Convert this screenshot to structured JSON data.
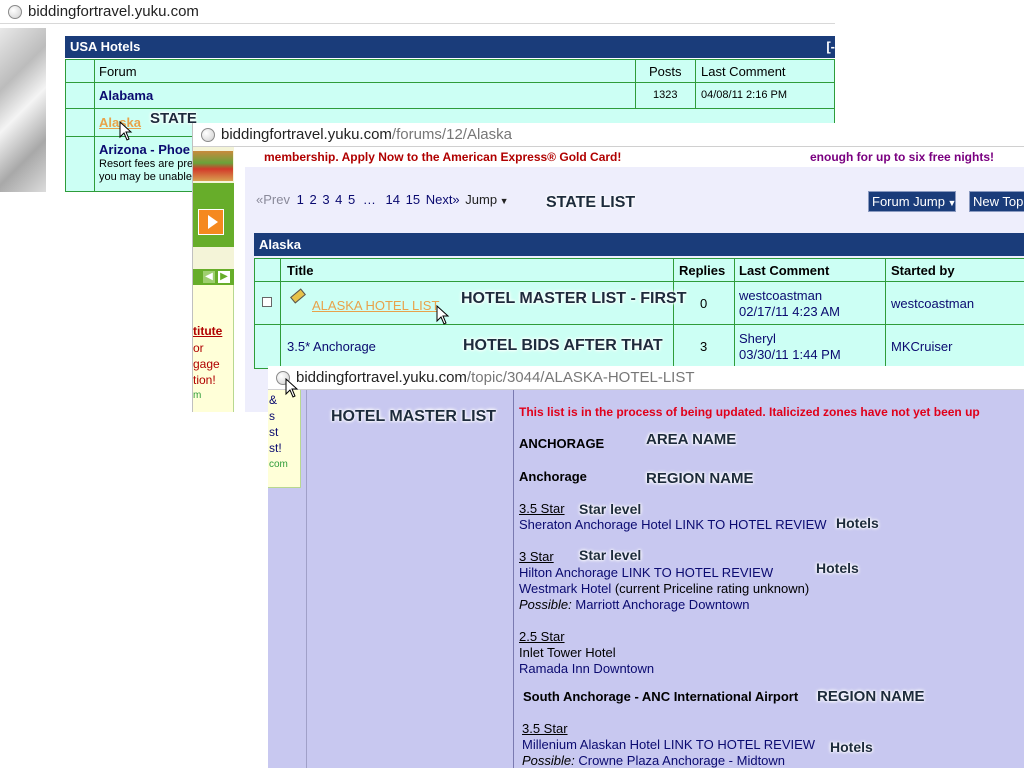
{
  "win1": {
    "url": "biddingfortravel.yuku.com",
    "section_title": "USA Hotels",
    "collapse_glyph": "[-",
    "headers": {
      "forum": "Forum",
      "posts": "Posts",
      "last": "Last Comment"
    },
    "rows": [
      {
        "name": "Alabama",
        "posts": "1323",
        "last": "04/08/11 2:16 PM"
      },
      {
        "name": "Alaska"
      },
      {
        "name": "Arizona - Phoe",
        "desc1": "Resort fees are pre",
        "desc2": "you may be unable"
      }
    ]
  },
  "win2": {
    "url_host": "biddingfortravel.yuku.com",
    "url_path": "/forums/12/Alaska",
    "ad_left": "membership. Apply Now to the American Express® Gold Card!",
    "ad_right": "enough for up to six free nights!",
    "pager": {
      "prev": "«Prev",
      "pages": [
        "1",
        "2",
        "3",
        "4",
        "5",
        "…",
        "14",
        "15"
      ],
      "next": "Next»",
      "jump": "Jump"
    },
    "forum_jump": "Forum Jump",
    "new_topic": "New Topi",
    "forum_title": "Alaska",
    "headers": {
      "title": "Title",
      "replies": "Replies",
      "last": "Last Comment",
      "started": "Started by"
    },
    "rows": [
      {
        "title": "ALASKA HOTEL LIST",
        "replies": "0",
        "last_user": "westcoastman",
        "last_date": "02/17/11 4:23 AM",
        "started": "westcoastman"
      },
      {
        "title": "3.5* Anchorage",
        "replies": "3",
        "last_user": "Sheryl",
        "last_date": "03/30/11 1:44 PM",
        "started": "MKCruiser"
      }
    ],
    "side_ad": {
      "l1": "titute",
      "l2": "or",
      "l3": "gage",
      "l4": "tion!",
      "l5": "m",
      "l6": "&",
      "l7": "s",
      "l8": "st",
      "l9": "st!",
      "l10": "com"
    }
  },
  "win3": {
    "url_host": "biddingfortravel.yuku.com",
    "url_path": "/topic/3044/ALASKA-HOTEL-LIST",
    "notice": "This list is in the process of being updated. Italicized zones have not yet been up",
    "area": "ANCHORAGE",
    "region1": "Anchorage",
    "s35": "3.5 Star",
    "sheraton": "Sheraton Anchorage Hotel LINK TO HOTEL REVIEW",
    "s3": "3 Star",
    "hilton": "Hilton Anchorage LINK TO HOTEL REVIEW",
    "westmark": "Westmark Hotel",
    "westmark_note": " (current Priceline rating unknown)",
    "possible_label": "Possible:",
    "marriott": " Marriott Anchorage Downtown",
    "s25": "2.5 Star",
    "inlet": "Inlet Tower Hotel",
    "ramada": "Ramada Inn Downtown",
    "region2": "South Anchorage - ANC International Airport",
    "s35b": "3.5 Star",
    "millenium": "Millenium Alaskan Hotel LINK TO HOTEL REVIEW",
    "crowne": " Crowne Plaza Anchorage - Midtown"
  },
  "annotations": {
    "state": "STATE",
    "state_list": "STATE LIST",
    "master_first": "HOTEL MASTER LIST - FIRST",
    "bids_after": "HOTEL BIDS AFTER THAT",
    "master_list": "HOTEL MASTER LIST",
    "area_name": "AREA NAME",
    "region_name": "REGION NAME",
    "star_level": "Star level",
    "hotels": "Hotels"
  },
  "colors": {
    "header_navy": "#1a3c7a",
    "row_cyan": "#ccfff4",
    "body_lavender": "#c8c8f0",
    "grid_green": "#2e9c3a",
    "link_navy": "#0a0a70",
    "notice_red": "#e0001a"
  }
}
